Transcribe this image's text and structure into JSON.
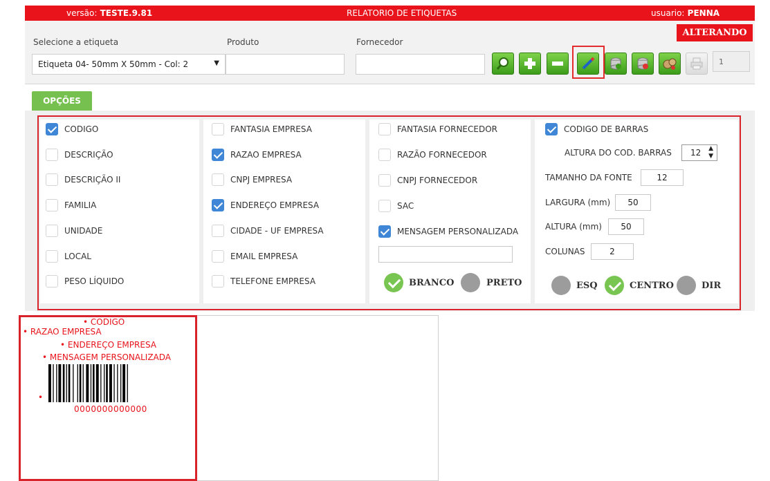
{
  "topbar": {
    "version_label": "versão:",
    "version_value": "TESTE.9.81",
    "title": "RELATORIO DE ETIQUETAS",
    "user_label": "usuario:",
    "user_value": "PENNA"
  },
  "filters": {
    "label_select": "Selecione a etiqueta",
    "label_value": "Etiqueta 04- 50mm X 50mm - Col: 2",
    "product_label": "Produto",
    "product_value": "",
    "supplier_label": "Fornecedor",
    "supplier_value": ""
  },
  "status_badge": "ALTERANDO",
  "toolbar": {
    "buttons": [
      "search-icon",
      "add-icon",
      "remove-icon",
      "edit-icon",
      "database-icon",
      "database-delete-icon",
      "money-bag-icon",
      "printer-icon"
    ],
    "copies_value": "1"
  },
  "options_tab": "OPÇÕES",
  "column1": [
    {
      "label": "CODIGO",
      "checked": true
    },
    {
      "label": "DESCRIÇÃO",
      "checked": false
    },
    {
      "label": "DESCRIÇÃO II",
      "checked": false
    },
    {
      "label": "FAMILIA",
      "checked": false
    },
    {
      "label": "UNIDADE",
      "checked": false
    },
    {
      "label": "LOCAL",
      "checked": false
    },
    {
      "label": "PESO LÍQUIDO",
      "checked": false
    }
  ],
  "column2": [
    {
      "label": "FANTASIA EMPRESA",
      "checked": false
    },
    {
      "label": "RAZAO EMPRESA",
      "checked": true
    },
    {
      "label": "CNPJ EMPRESA",
      "checked": false
    },
    {
      "label": "ENDEREÇO EMPRESA",
      "checked": true
    },
    {
      "label": "CIDADE - UF EMPRESA",
      "checked": false
    },
    {
      "label": "EMAIL EMPRESA",
      "checked": false
    },
    {
      "label": "TELEFONE EMPRESA",
      "checked": false
    }
  ],
  "column3": [
    {
      "label": "FANTASIA FORNECEDOR",
      "checked": false
    },
    {
      "label": "RAZÃO FORNECEDOR",
      "checked": false
    },
    {
      "label": "CNPJ FORNECEDOR",
      "checked": false
    },
    {
      "label": "SAC",
      "checked": false
    },
    {
      "label": "MENSAGEM PERSONALIZADA",
      "checked": true
    }
  ],
  "custom_message_value": "",
  "color_options": {
    "branco": "BRANCO",
    "preto": "PRETO",
    "selected": "BRANCO"
  },
  "column4": {
    "barcode_label": "CODIGO DE BARRAS",
    "barcode_checked": true,
    "barcode_height_label": "ALTURA DO COD. BARRAS",
    "barcode_height_value": "12",
    "font_size_label": "TAMANHO DA FONTE",
    "font_size_value": "12",
    "width_label": "LARGURA (mm)",
    "width_value": "50",
    "height_label": "ALTURA (mm)",
    "height_value": "50",
    "columns_label": "COLUNAS",
    "columns_value": "2"
  },
  "align_options": {
    "esq": "ESQ",
    "centro": "CENTRO",
    "dir": "DIR",
    "selected": "CENTRO"
  },
  "preview": {
    "line1": "CODIGO",
    "line2": "RAZAO EMPRESA",
    "line3": "ENDEREÇO EMPRESA",
    "line4": "MENSAGEM PERSONALIZADA",
    "barcode_number": "0000000000000"
  },
  "colors": {
    "accent_red": "#e8131b",
    "tab_green": "#76c04f",
    "check_blue": "#3f87d6"
  }
}
